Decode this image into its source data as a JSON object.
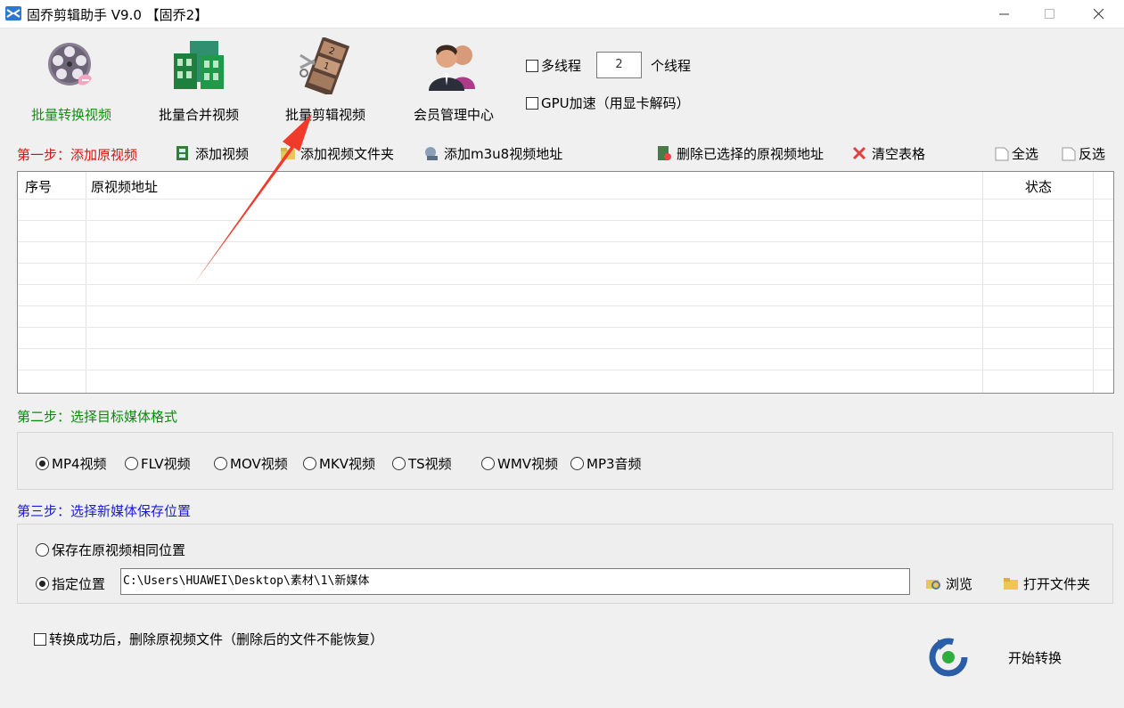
{
  "window": {
    "title": "固乔剪辑助手 V9.0 【固乔2】",
    "controls": [
      "minimize",
      "maximize",
      "close"
    ]
  },
  "toolbar": {
    "tools": [
      {
        "label": "批量转换视频",
        "icon": "film-reel-convert-icon",
        "active": true
      },
      {
        "label": "批量合并视频",
        "icon": "merge-building-icon",
        "active": false
      },
      {
        "label": "批量剪辑视频",
        "icon": "film-cut-icon",
        "active": false
      },
      {
        "label": "会员管理中心",
        "icon": "members-icon",
        "active": false
      }
    ],
    "multithread_label": "多线程",
    "thread_count": "2",
    "thread_unit": "个线程",
    "gpu_label": "GPU加速（用显卡解码）"
  },
  "step1": {
    "label": "第一步：添加原视频",
    "add_video": "添加视频",
    "add_folder": "添加视频文件夹",
    "add_m3u8": "添加m3u8视频地址",
    "delete_selected": "删除已选择的原视频地址",
    "clear_table": "清空表格",
    "select_all": "全选",
    "invert_select": "反选"
  },
  "table": {
    "columns": [
      "序号",
      "原视频地址",
      "状态"
    ],
    "rows": []
  },
  "step2": {
    "label": "第二步：选择目标媒体格式",
    "formats": [
      {
        "label": "MP4视频",
        "selected": true
      },
      {
        "label": "FLV视频",
        "selected": false
      },
      {
        "label": "MOV视频",
        "selected": false
      },
      {
        "label": "MKV视频",
        "selected": false
      },
      {
        "label": "TS视频",
        "selected": false
      },
      {
        "label": "WMV视频",
        "selected": false
      },
      {
        "label": "MP3音频",
        "selected": false
      }
    ]
  },
  "step3": {
    "label": "第三步：选择新媒体保存位置",
    "same_location": "保存在原视频相同位置",
    "custom_location": "指定位置",
    "path": "C:\\Users\\HUAWEI\\Desktop\\素材\\1\\新媒体",
    "browse": "浏览",
    "open_folder": "打开文件夹"
  },
  "footer": {
    "delete_after": "转换成功后，删除原视频文件（删除后的文件不能恢复）",
    "start": "开始转换"
  },
  "colors": {
    "step1": "#e01010",
    "step2": "#0a8a0a",
    "step3": "#1a1adc",
    "annotation_arrow": "#f03a2a"
  }
}
